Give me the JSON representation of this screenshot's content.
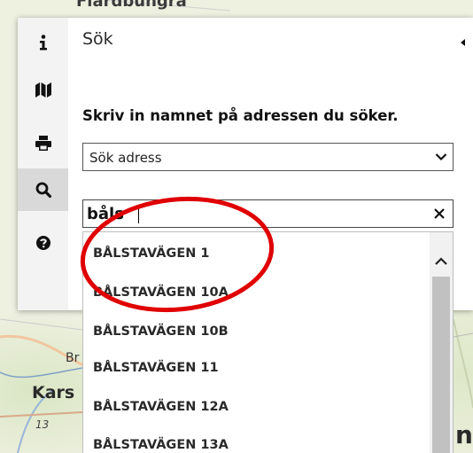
{
  "map": {
    "place_top": "Flardbungra",
    "place_kars": "Kars",
    "place_br": "Br",
    "road_number": "13",
    "place_edge": "n"
  },
  "panel": {
    "title": "Sök",
    "instruction": "Skriv in namnet på adressen du söker.",
    "select": {
      "value": "Sök adress"
    },
    "search": {
      "value": "båls"
    },
    "tools": [
      {
        "name": "info",
        "icon": "info-icon"
      },
      {
        "name": "map",
        "icon": "map-icon"
      },
      {
        "name": "print",
        "icon": "print-icon"
      },
      {
        "name": "search",
        "icon": "search-icon",
        "active": true
      },
      {
        "name": "help",
        "icon": "help-icon"
      }
    ]
  },
  "results": {
    "items": [
      {
        "label": "BÅLSTAVÄGEN 1"
      },
      {
        "label": "BÅLSTAVÄGEN 10A"
      },
      {
        "label": "BÅLSTAVÄGEN 10B"
      },
      {
        "label": "BÅLSTAVÄGEN 11"
      },
      {
        "label": "BÅLSTAVÄGEN 12A"
      },
      {
        "label": "BÅLSTAVÄGEN 13A"
      }
    ]
  },
  "annotation": {
    "color": "#e00000"
  }
}
